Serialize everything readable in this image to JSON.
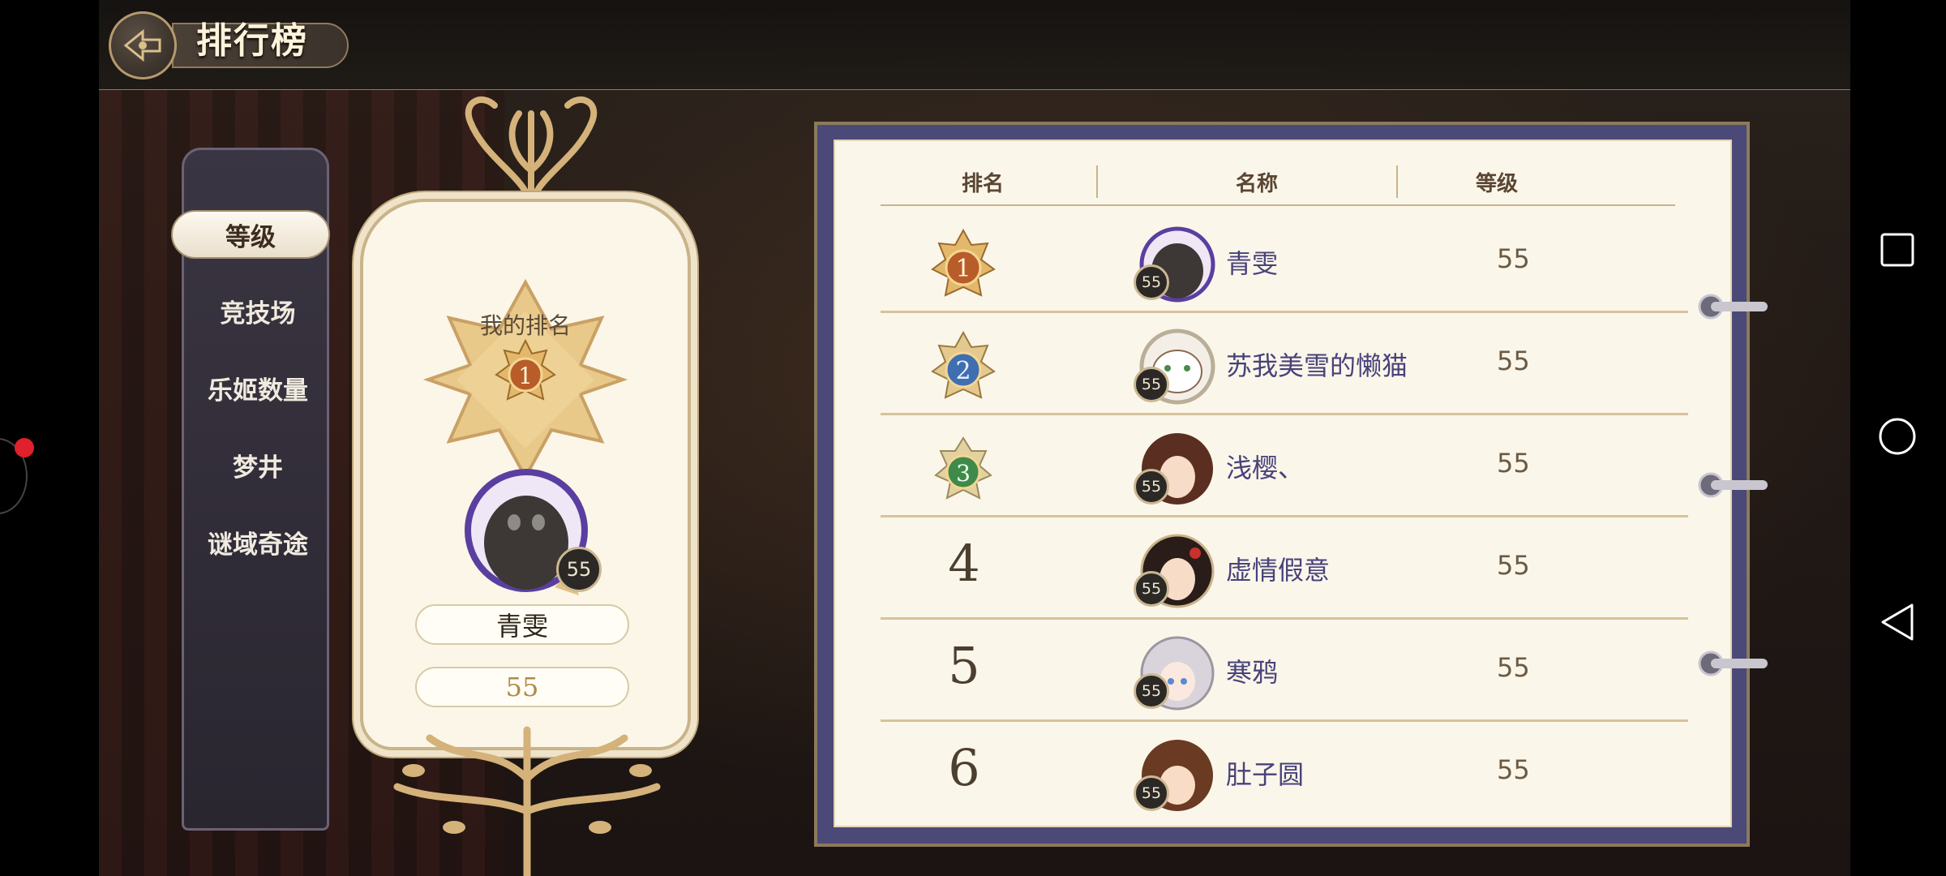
{
  "header": {
    "title": "排行榜"
  },
  "tabs": [
    {
      "label": "等级",
      "active": true
    },
    {
      "label": "竞技场",
      "active": false
    },
    {
      "label": "乐姬数量",
      "active": false
    },
    {
      "label": "梦井",
      "active": false
    },
    {
      "label": "谜域奇途",
      "active": false
    }
  ],
  "my_rank": {
    "label": "我的排名",
    "rank": "1",
    "avatar_level": "55",
    "name": "青雯",
    "level": "55"
  },
  "table": {
    "headers": {
      "rank": "排名",
      "name": "名称",
      "level": "等级"
    },
    "rows": [
      {
        "rank": "1",
        "avatar_level": "55",
        "name": "青雯",
        "level": "55"
      },
      {
        "rank": "2",
        "avatar_level": "55",
        "name": "苏我美雪的懒猫",
        "level": "55"
      },
      {
        "rank": "3",
        "avatar_level": "55",
        "name": "浅樱、",
        "level": "55"
      },
      {
        "rank": "4",
        "avatar_level": "55",
        "name": "虚情假意",
        "level": "55"
      },
      {
        "rank": "5",
        "avatar_level": "55",
        "name": "寒鸦",
        "level": "55"
      },
      {
        "rank": "6",
        "avatar_level": "55",
        "name": "肚子圆",
        "level": "55"
      }
    ]
  },
  "colors": {
    "accent_gold": "#c9a165",
    "book_cover": "#4b4978",
    "name_text": "#48427a",
    "nav_icons": "#ffffff"
  },
  "icons": {
    "back": "back-arrow-icon",
    "rank_1": "gold-medal-icon",
    "rank_2": "silver-medal-icon",
    "rank_3": "bronze-medal-icon",
    "nav_recent": "square-icon",
    "nav_home": "circle-icon",
    "nav_back": "triangle-icon"
  }
}
